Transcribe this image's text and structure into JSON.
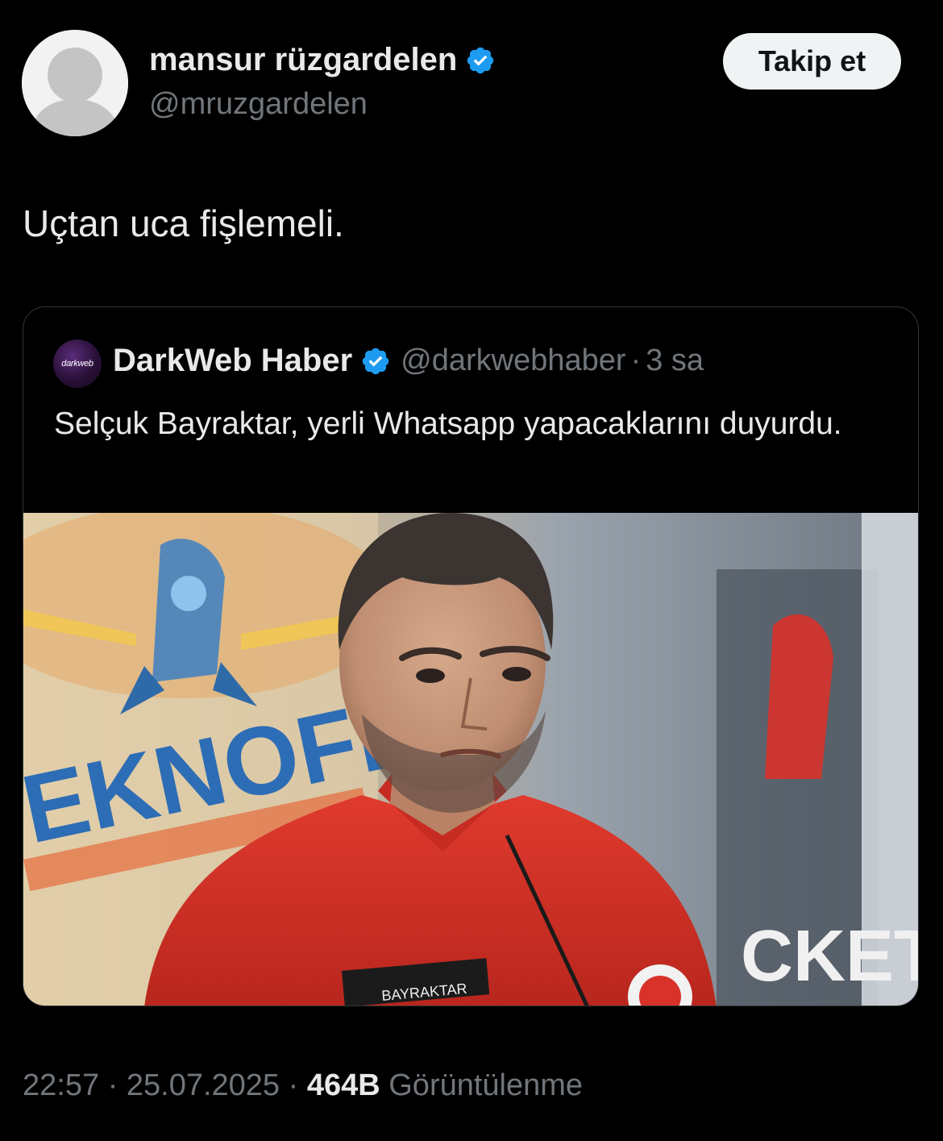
{
  "tweet": {
    "author": {
      "display_name": "mansur rüzgardelen",
      "handle": "@mruzgardelen",
      "verified_icon": "verified-badge-icon",
      "avatar_icon": "default-avatar-icon"
    },
    "follow_label": "Takip et",
    "text": "Uçtan uca fişlemeli.",
    "quoted": {
      "display_name": "DarkWeb Haber",
      "handle": "@darkwebhaber",
      "separator": "·",
      "time": "3 sa",
      "avatar_logo_text": "darkweb",
      "text": "Selçuk Bayraktar, yerli Whatsapp yapacaklarını duyurdu.",
      "image_description": "photo",
      "image_texts": {
        "banner": "EKNOFEST",
        "right_banner": "CKET",
        "name_tag": "BAYRAKTAR"
      }
    },
    "meta": {
      "time": "22:57",
      "separator": "·",
      "date": "25.07.2025",
      "views_count": "464B",
      "views_label": "Görüntülenme"
    }
  },
  "colors": {
    "background": "#000000",
    "primary_text": "#e7e9ea",
    "secondary_text": "#71767b",
    "verified_blue": "#1d9bf0",
    "follow_button_bg": "#eff3f4",
    "card_border": "#333639"
  }
}
